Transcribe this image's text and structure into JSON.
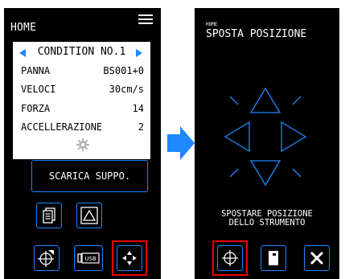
{
  "left_screen": {
    "title": "HOME",
    "condition_label": "CONDITION NO.1",
    "rows": [
      {
        "key": "PANNA",
        "value": "BS001+0"
      },
      {
        "key": "VELOCI",
        "value": "30cm/s"
      },
      {
        "key": "FORZA",
        "value": "14"
      },
      {
        "key": "ACCELLERAZIONE",
        "value": "2"
      }
    ],
    "buttons": {
      "feed": "SCARICA SUPPO.",
      "usb": "USB"
    }
  },
  "right_screen": {
    "breadcrumb": "HOME",
    "title": "SPOSTA POSIZIONE",
    "caption_line1": "SPOSTARE POSIZIONE",
    "caption_line2": "DELLO STRUMENTO"
  },
  "colors": {
    "accent": "#1e88ff",
    "highlight": "#e00000",
    "background": "#000000",
    "panel": "#ffffff"
  },
  "icons": [
    "menu-icon",
    "left-arrow-icon",
    "right-arrow-icon",
    "gear-icon",
    "document-icon",
    "triangle-icon",
    "origin-icon",
    "usb-icon",
    "move-arrows-icon",
    "crosshair-icon",
    "pen-holder-icon",
    "close-icon",
    "right-arrow-pointer"
  ]
}
